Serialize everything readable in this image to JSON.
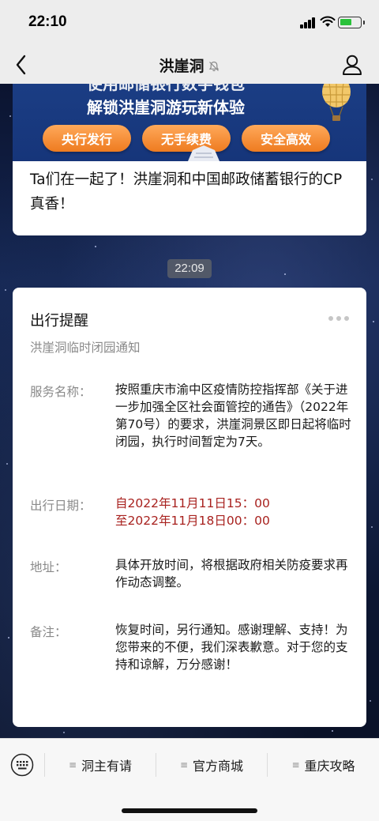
{
  "status_bar": {
    "time": "22:10"
  },
  "nav": {
    "title": "洪崖洞"
  },
  "article": {
    "banner_line1": "使用邮储银行数字钱包",
    "banner_line2": "解锁洪崖洞游玩新体验",
    "pills": [
      "央行发行",
      "无手续费",
      "安全高效"
    ],
    "title": "Ta们在一起了！洪崖洞和中国邮政储蓄银行的CP真香！"
  },
  "timestamp": "22:09",
  "notice": {
    "title": "出行提醒",
    "subtitle": "洪崖洞临时闭园通知",
    "fields": [
      {
        "label": "服务名称：",
        "value": " 按照重庆市渝中区疫情防控指挥部《关于进一步加强全区社会面管控的通告》（2022年第70号）的要求，洪崖洞景区即日起将临时闭园，执行时间暂定为7天。"
      },
      {
        "label": "出行日期：",
        "value": "自2022年11月11日15：00\n至2022年11月18日00：00"
      },
      {
        "label": "地址：",
        "value": "具体开放时间，将根据政府相关防疫要求再作动态调整。"
      },
      {
        "label": "备注：",
        "value": "恢复时间，另行通知。感谢理解、支持！为您带来的不便，我们深表歉意。对于您的支持和谅解，万分感谢！"
      }
    ]
  },
  "bottom_menu": {
    "items": [
      "洞主有请",
      "官方商城",
      "重庆攻略"
    ]
  },
  "colors": {
    "accent_orange": "#ee7b20",
    "date_red": "#a8211e",
    "banner_blue": "#1c3f86"
  }
}
